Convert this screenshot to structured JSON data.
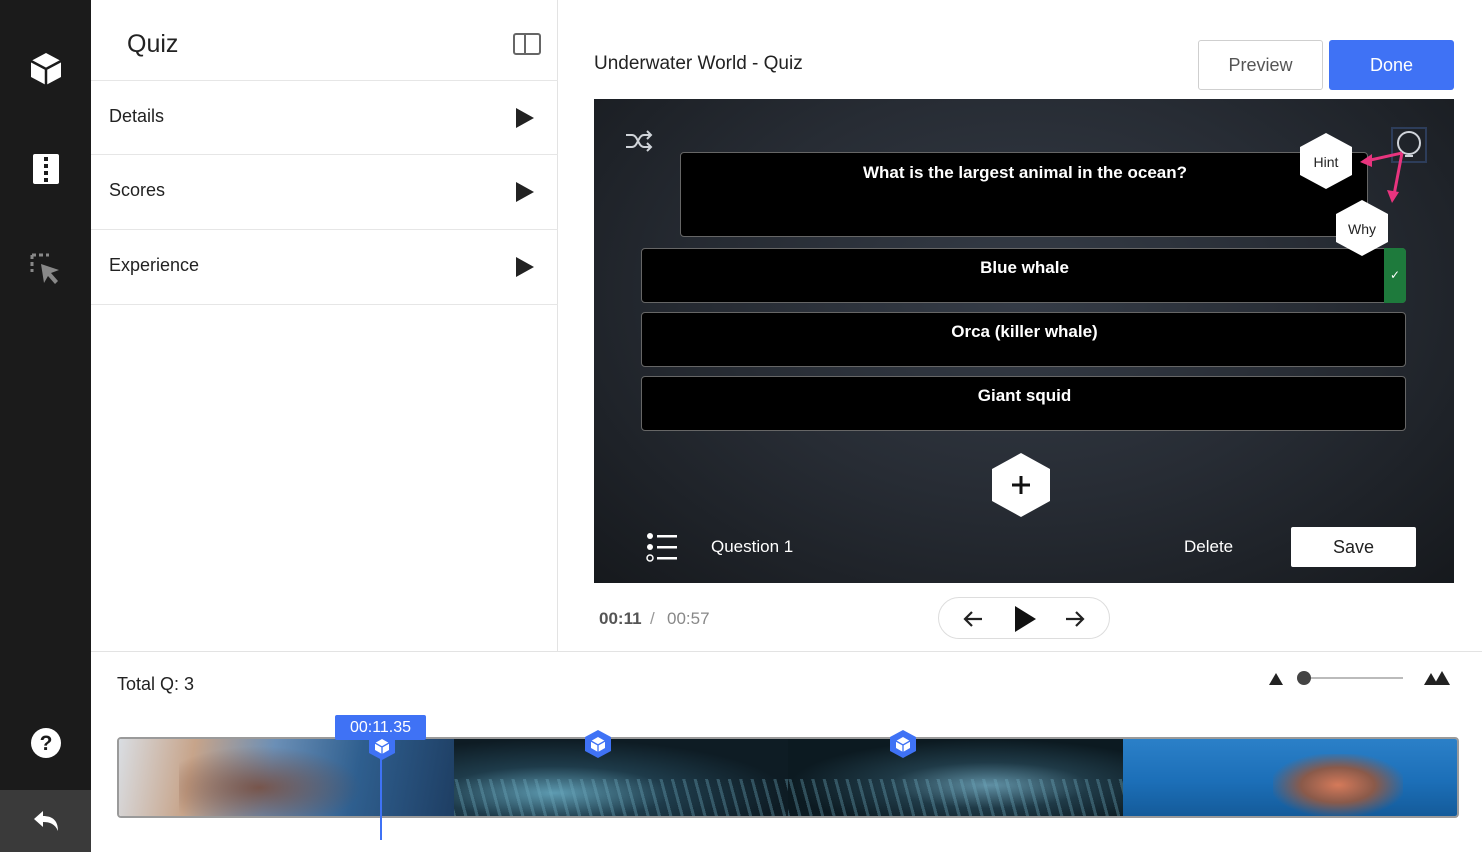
{
  "rail": {
    "icons": [
      "cube-icon",
      "film-icon",
      "cursor-select-icon",
      "help-icon",
      "back-icon"
    ]
  },
  "panel": {
    "title": "Quiz",
    "sections": [
      {
        "label": "Details"
      },
      {
        "label": "Scores"
      },
      {
        "label": "Experience"
      }
    ]
  },
  "header": {
    "title": "Underwater World - Quiz",
    "preview_label": "Preview",
    "done_label": "Done"
  },
  "quiz": {
    "question": "What is the largest animal in the ocean?",
    "answers": [
      {
        "text": "Blue whale",
        "correct": true
      },
      {
        "text": "Orca (killer whale)",
        "correct": false
      },
      {
        "text": "Giant squid",
        "correct": false
      }
    ],
    "hint_label": "Hint",
    "why_label": "Why",
    "footer_question": "Question 1",
    "delete_label": "Delete",
    "save_label": "Save"
  },
  "player": {
    "current_time": "00:11",
    "separator": "/",
    "total_time": "00:57"
  },
  "timeline": {
    "total_label": "Total Q: 3",
    "playhead_time": "00:11.35",
    "zoom_level": 0.05
  },
  "colors": {
    "accent": "#3f72f5",
    "correct": "#1e7a3c",
    "arrow": "#e8347e",
    "rail": "#1b1b1b"
  }
}
